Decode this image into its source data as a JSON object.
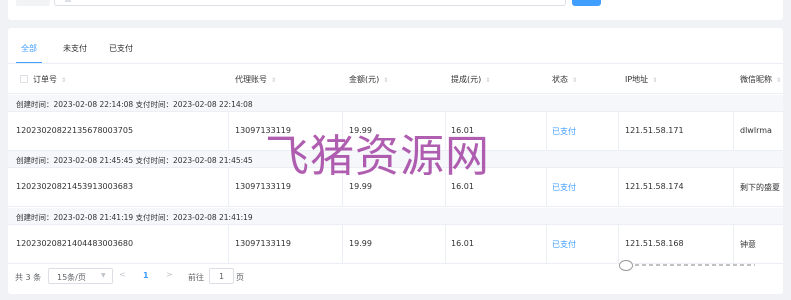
{
  "tabs": [
    "全部",
    "未支付",
    "已支付"
  ],
  "columns": {
    "order_no": "订单号",
    "agent": "代理账号",
    "amount": "金额(元)",
    "commission": "提成(元)",
    "status": "状态",
    "ip": "IP地址",
    "wechat": "微信昵称"
  },
  "groups": [
    {
      "header": "创建时间：2023-02-08 22:14:08   支付时间：2023-02-08 22:14:08",
      "order_no": "120230208221356780037​05",
      "agent": "13097133119",
      "amount": "19.99",
      "commission": "16.01",
      "status": "已支付",
      "ip": "121.51.58.171",
      "wechat": "dlwlrma"
    },
    {
      "header": "创建时间：2023-02-08 21:45:45   支付时间：2023-02-08 21:45:45",
      "order_no": "12023020821453913003683",
      "agent": "13097133119",
      "amount": "19.99",
      "commission": "16.01",
      "status": "已支付",
      "ip": "121.51.58.174",
      "wechat": "剩下的盛夏"
    },
    {
      "header": "创建时间：2023-02-08 21:41:19   支付时间：2023-02-08 21:41:19",
      "order_no": "12023020821404483003680",
      "agent": "13097133119",
      "amount": "19.99",
      "commission": "16.01",
      "status": "已支付",
      "ip": "121.51.58.168",
      "wechat": "钟意"
    }
  ],
  "pagination": {
    "total": "共 3 条",
    "page_size": "15条/页",
    "current_page": "1",
    "goto_label": "前往",
    "goto_value": "1",
    "page_suffix": "页"
  },
  "watermark": "飞猪资源网",
  "colors": {
    "accent": "#409eff",
    "watermark": "#962896"
  },
  "icons": {
    "sort": "sort-caret-icon",
    "prev": "chevron-left-icon",
    "next": "chevron-right-icon",
    "dropdown": "chevron-down-icon"
  }
}
